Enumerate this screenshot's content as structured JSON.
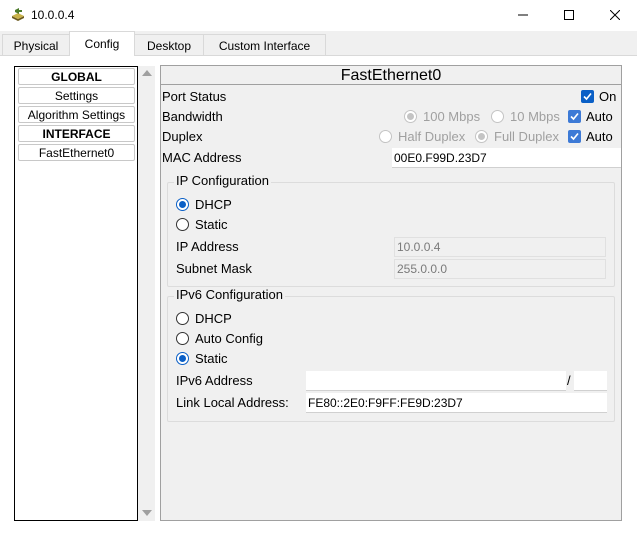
{
  "window": {
    "title": "10.0.0.4",
    "icon": "router-icon",
    "controls": {
      "minimize": "minimize-icon",
      "maximize": "maximize-icon",
      "close": "close-icon"
    }
  },
  "tabs": [
    {
      "label": "Physical",
      "active": false
    },
    {
      "label": "Config",
      "active": true
    },
    {
      "label": "Desktop",
      "active": false
    },
    {
      "label": "Custom Interface",
      "active": false
    }
  ],
  "sidebar": {
    "items": [
      {
        "label": "GLOBAL",
        "type": "header"
      },
      {
        "label": "Settings",
        "type": "button"
      },
      {
        "label": "Algorithm Settings",
        "type": "button"
      },
      {
        "label": "INTERFACE",
        "type": "header"
      },
      {
        "label": "FastEthernet0",
        "type": "button"
      }
    ]
  },
  "panel": {
    "title": "FastEthernet0",
    "port_status": {
      "label": "Port Status",
      "option": "On",
      "checked": true
    },
    "bandwidth": {
      "label": "Bandwidth",
      "option_100": "100 Mbps",
      "option_10": "10 Mbps",
      "selected": "100 Mbps",
      "auto_label": "Auto",
      "auto_checked": true
    },
    "duplex": {
      "label": "Duplex",
      "option_half": "Half Duplex",
      "option_full": "Full Duplex",
      "selected": "Full Duplex",
      "auto_label": "Auto",
      "auto_checked": true
    },
    "mac": {
      "label": "MAC Address",
      "value": "00E0.F99D.23D7"
    },
    "ip_config": {
      "title": "IP Configuration",
      "dhcp_label": "DHCP",
      "static_label": "Static",
      "selected": "DHCP",
      "ip_label": "IP Address",
      "ip_value": "10.0.0.4",
      "mask_label": "Subnet Mask",
      "mask_value": "255.0.0.0"
    },
    "ipv6_config": {
      "title": "IPv6 Configuration",
      "dhcp_label": "DHCP",
      "auto_label": "Auto Config",
      "static_label": "Static",
      "selected": "Static",
      "addr_label": "IPv6 Address",
      "addr_value": "",
      "prefix_sep": "/",
      "prefix_value": "",
      "link_local_label": "Link Local Address:",
      "link_local_value": "FE80::2E0:F9FF:FE9D:23D7"
    }
  },
  "colors": {
    "accent": "#0a5fc6",
    "disabled": "#a0a0a0",
    "window_bg": "#f0f0f0"
  }
}
